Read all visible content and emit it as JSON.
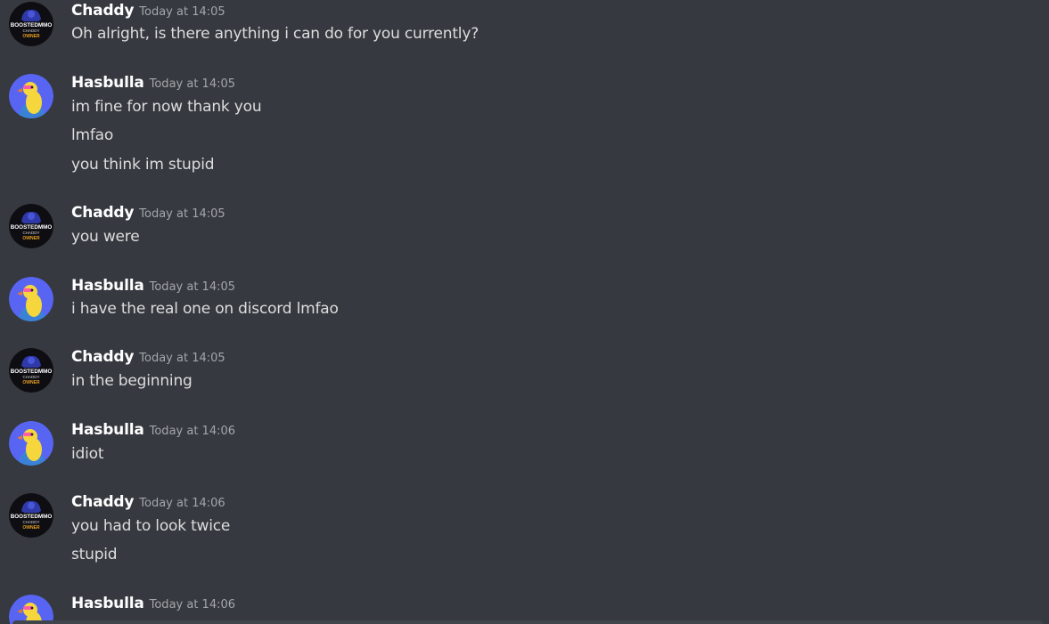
{
  "colors": {
    "background": "#36393f",
    "author": "#ffffff",
    "timestamp": "#a3a6aa",
    "message_text": "#dcddde",
    "hasbulla_avatar_bg": "#5865f2",
    "chaddy_avatar_bg": "#0d0d12"
  },
  "users": {
    "chaddy": {
      "name": "Chaddy",
      "avatar_icon": "boosted-mmo-logo-icon",
      "avatar_text": [
        "BOOSTEDMMO",
        "CHADDY",
        "OWNER"
      ]
    },
    "hasbulla": {
      "name": "Hasbulla",
      "avatar_icon": "yellow-duck-avatar-icon"
    }
  },
  "messages": [
    {
      "author": "Chaddy",
      "timestamp": "Today at 14:05",
      "lines": [
        "Oh alright, is there anything i can do for you currently?"
      ]
    },
    {
      "author": "Hasbulla",
      "timestamp": "Today at 14:05",
      "lines": [
        "im fine for now thank you",
        "lmfao",
        "you think im stupid"
      ]
    },
    {
      "author": "Chaddy",
      "timestamp": "Today at 14:05",
      "lines": [
        "you were"
      ]
    },
    {
      "author": "Hasbulla",
      "timestamp": "Today at 14:05",
      "lines": [
        "i have the real one on discord lmfao"
      ]
    },
    {
      "author": "Chaddy",
      "timestamp": "Today at 14:05",
      "lines": [
        "in the beginning"
      ]
    },
    {
      "author": "Hasbulla",
      "timestamp": "Today at 14:06",
      "lines": [
        "idiot"
      ]
    },
    {
      "author": "Chaddy",
      "timestamp": "Today at 14:06",
      "lines": [
        "you had to look twice",
        "stupid"
      ]
    },
    {
      "author": "Hasbulla",
      "timestamp": "Today at 14:06",
      "lines": []
    }
  ]
}
